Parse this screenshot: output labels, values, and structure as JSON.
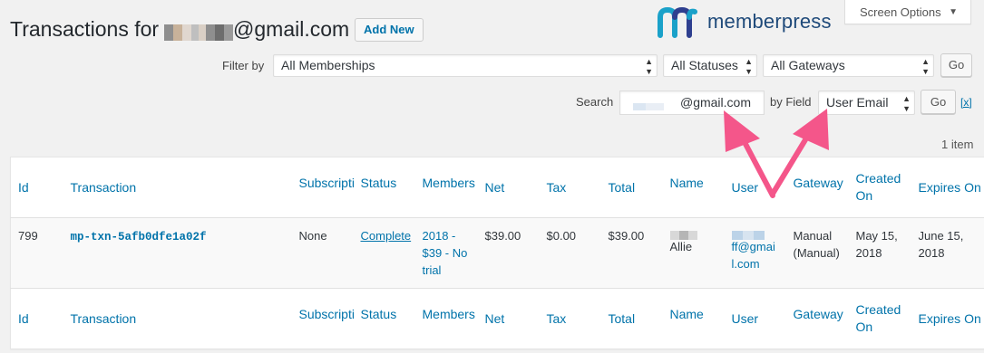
{
  "header": {
    "title_prefix": "Transactions for",
    "title_suffix": "@gmail.com",
    "add_new_label": "Add New",
    "logo_text": "memberpress",
    "screen_options_label": "Screen Options"
  },
  "filters": {
    "filter_by_label": "Filter by",
    "membership_select": "All Memberships",
    "status_select": "All Statuses",
    "gateway_select": "All Gateways",
    "go_label": "Go"
  },
  "search": {
    "search_label": "Search",
    "search_value": "@gmail.com",
    "by_field_label": "by Field",
    "field_select": "User Email",
    "go_label": "Go",
    "clear_label": "[x]"
  },
  "items_count": "1 item",
  "colors": {
    "accent": "#0073aa",
    "arrow": "#f4568a",
    "logo_teal": "#1aa1c9",
    "logo_purple": "#2e3f8f"
  },
  "table": {
    "columns": [
      "Id",
      "Transaction",
      "Subscripti",
      "Status",
      "Members",
      "Net",
      "Tax",
      "Total",
      "Name",
      "User",
      "Gateway",
      "Created On",
      "Expires On"
    ],
    "row": {
      "id": "799",
      "transaction": "mp-txn-5afb0dfe1a02f",
      "subscription": "None",
      "status": "Complete",
      "membership": "2018 - $39 - No trial",
      "net": "$39.00",
      "tax": "$0.00",
      "total": "$39.00",
      "name": "Allie",
      "user": "ff@gmail.com",
      "gateway": "Manual (Manual)",
      "created": "May 15, 2018",
      "expires": "June 15, 2018"
    }
  }
}
